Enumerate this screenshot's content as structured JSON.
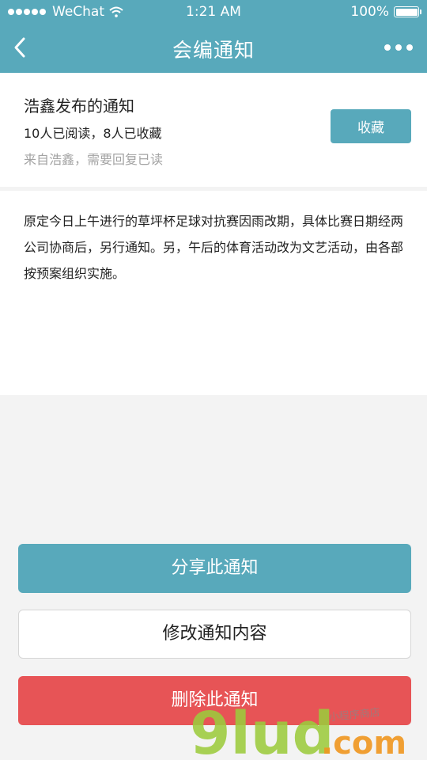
{
  "status_bar": {
    "carrier": "WeChat",
    "time": "1:21 AM",
    "battery": "100%",
    "battery_level": 1.0,
    "icons": [
      "signal-dots-icon",
      "wifi-icon",
      "battery-icon"
    ]
  },
  "nav": {
    "title": "会编通知",
    "icons": [
      "back-chevron-icon",
      "more-dots-icon"
    ]
  },
  "notice": {
    "name": "浩鑫发布的通知",
    "stats": "10人已阅读，8人已收藏",
    "source": "来自浩鑫，需要回复已读",
    "favorite_label": "收藏"
  },
  "content": {
    "body": "原定今日上午进行的草坪杯足球对抗赛因雨改期，具体比赛日期经两公司协商后，另行通知。另，午后的体育活动改为文艺活动，由各部按预案组织实施。"
  },
  "actions": {
    "share_label": "分享此通知",
    "edit_label": "修改通知内容",
    "delete_label": "删除此通知"
  },
  "watermark": {
    "brand": "9lud",
    "domain": ".com",
    "tagline": "小程序商店"
  },
  "colors": {
    "primary": "#58a9bb",
    "danger": "#e75456",
    "background": "#f3f3f3",
    "muted_text": "#a3a3a3"
  }
}
